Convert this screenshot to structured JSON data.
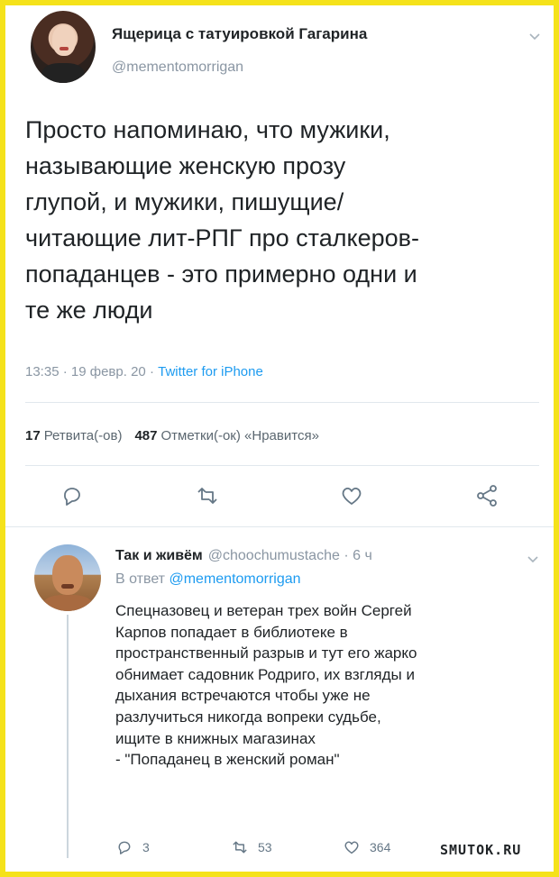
{
  "main_tweet": {
    "author_name": "Ящерица с татуировкой Гагарина",
    "handle": "@mementomorrigan",
    "text": "Просто напоминаю, что мужики,\nназывающие женскую прозу\nглупой, и мужики, пишущие/\nчитающие лит-РПГ про сталкеров-\nпопаданцев - это примерно одни и\nте же люди",
    "time": "13:35",
    "date": "19 февр. 20",
    "source": "Twitter for iPhone",
    "separator": "·",
    "retweets_count": "17",
    "retweets_label": "Ретвита(-ов)",
    "likes_count": "487",
    "likes_label": "Отметки(-ок) «Нравится»",
    "actions": [
      "reply-icon",
      "retweet-icon",
      "heart-icon",
      "share-icon"
    ]
  },
  "reply": {
    "author_name": "Так и живём",
    "handle": "@choochumustache",
    "age": "6 ч",
    "separator": "·",
    "in_reply_prefix": "В ответ",
    "in_reply_mention": "@mementomorrigan",
    "text": "Спецназовец и ветеран трех войн Сергей\nКарпов попадает в библиотеке в\nпространственный разрыв и тут его жарко\nобнимает садовник Родриго, их взгляды и\nдыхания встречаются чтобы уже не\nразлучиться никогда вопреки судьбе,\nищите в книжных магазинах\n- \"Попаданец в женский роман\"",
    "reply_count": "3",
    "retweet_count": "53",
    "like_count": "364"
  },
  "watermark": "SMUTOK.RU",
  "colors": {
    "frame": "#f5e21a",
    "link": "#1d9bf0",
    "muted": "#8a96a3",
    "text": "#1f2326"
  }
}
